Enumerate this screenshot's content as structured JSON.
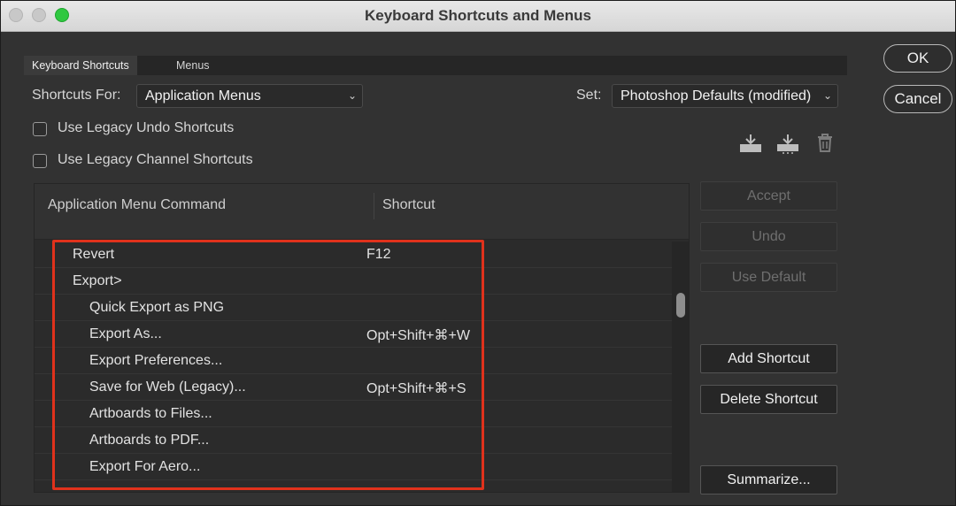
{
  "window": {
    "title": "Keyboard Shortcuts and Menus"
  },
  "tabs": [
    {
      "label": "Keyboard Shortcuts",
      "active": true
    },
    {
      "label": "Menus",
      "active": false
    }
  ],
  "shortcuts_for": {
    "label": "Shortcuts For:",
    "value": "Application Menus"
  },
  "set": {
    "label": "Set:",
    "value": "Photoshop Defaults (modified)"
  },
  "options": [
    {
      "label": "Use Legacy Undo Shortcuts",
      "checked": false
    },
    {
      "label": "Use Legacy Channel Shortcuts",
      "checked": false
    }
  ],
  "set_icons": [
    "save-set-icon",
    "save-as-set-icon",
    "trash-icon"
  ],
  "table": {
    "headers": [
      "Application Menu Command",
      "Shortcut"
    ],
    "rows": [
      {
        "command": "Revert",
        "shortcut": "F12",
        "indent": 0
      },
      {
        "command": "Export>",
        "shortcut": "",
        "indent": 0
      },
      {
        "command": "Quick Export as PNG",
        "shortcut": "",
        "indent": 1
      },
      {
        "command": "Export As...",
        "shortcut": "Opt+Shift+⌘+W",
        "indent": 1
      },
      {
        "command": "Export Preferences...",
        "shortcut": "",
        "indent": 1
      },
      {
        "command": "Save for Web (Legacy)...",
        "shortcut": "Opt+Shift+⌘+S",
        "indent": 1
      },
      {
        "command": "Artboards to Files...",
        "shortcut": "",
        "indent": 1
      },
      {
        "command": "Artboards to PDF...",
        "shortcut": "",
        "indent": 1
      },
      {
        "command": "Export For Aero...",
        "shortcut": "",
        "indent": 1
      }
    ]
  },
  "side_buttons": {
    "accept": "Accept",
    "undo": "Undo",
    "use_default": "Use Default",
    "add_shortcut": "Add Shortcut",
    "delete_shortcut": "Delete Shortcut",
    "summarize": "Summarize..."
  },
  "dialog_buttons": {
    "ok": "OK",
    "cancel": "Cancel"
  },
  "colors": {
    "highlight": "#e0321c",
    "zoom_button": "#2fc840"
  }
}
